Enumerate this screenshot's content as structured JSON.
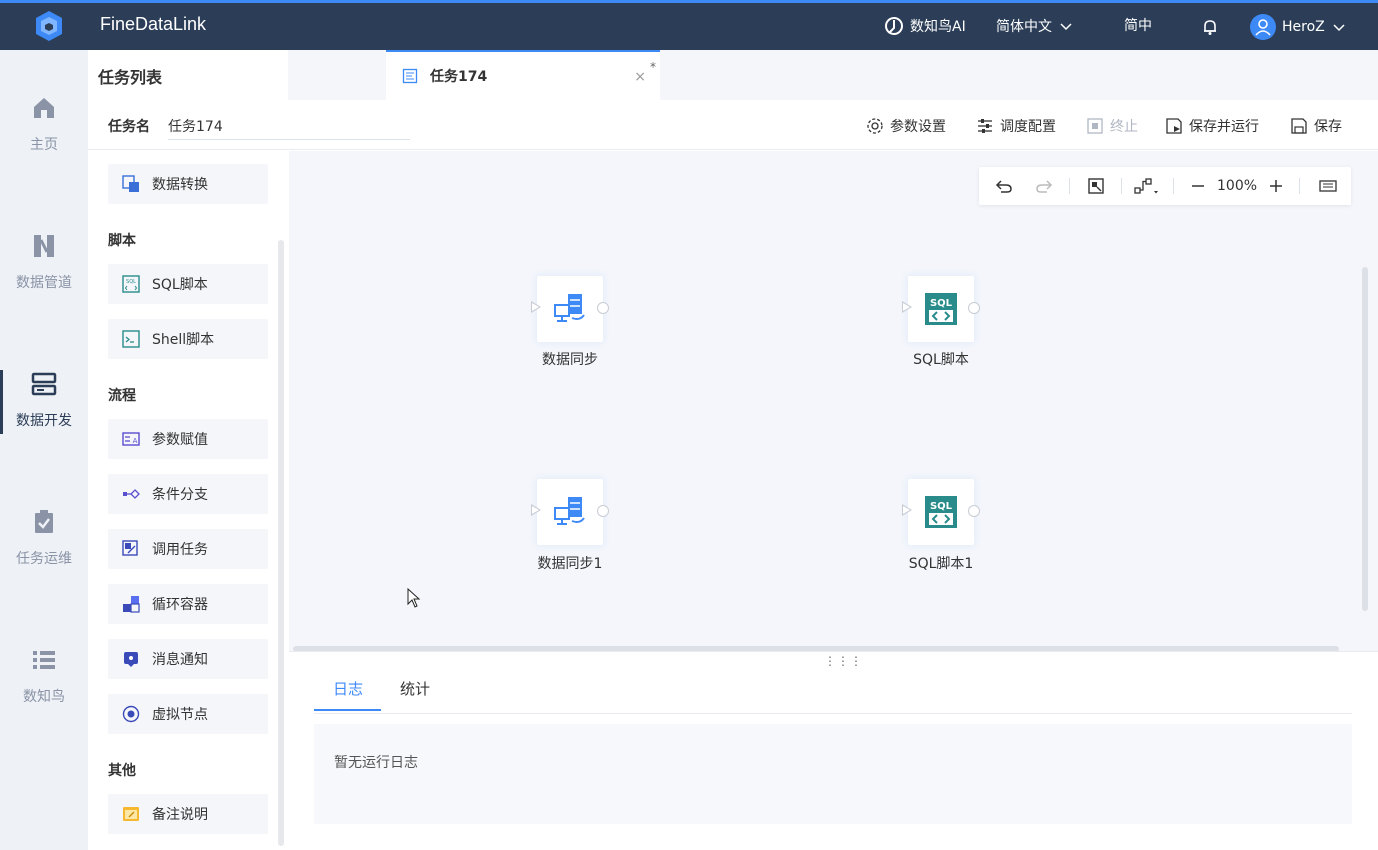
{
  "app": {
    "title": "FineDataLink",
    "brand_color": "#2c3e57",
    "accent_color": "#3d8af7"
  },
  "topbar": {
    "ai_label": "数知鸟AI",
    "language": "简体中文",
    "locale_short": "简中",
    "user": "HeroZ",
    "icons": [
      "cube-logo-icon",
      "ai-bird-icon",
      "chevron-down-icon",
      "bell-icon",
      "user-avatar-icon"
    ]
  },
  "leftnav": {
    "items": [
      {
        "label": "主页",
        "icon": "home-icon"
      },
      {
        "label": "数据管道",
        "icon": "pipeline-icon"
      },
      {
        "label": "数据开发",
        "icon": "dev-icon"
      },
      {
        "label": "任务运维",
        "icon": "task-ops-icon"
      },
      {
        "label": "数知鸟",
        "icon": "list-icon"
      }
    ],
    "active": "数据开发"
  },
  "panel": {
    "title": "任务列表",
    "components": [
      {
        "label": "数据转换",
        "icon": "data-transform-icon"
      }
    ],
    "groups": [
      {
        "label": "脚本",
        "items": [
          {
            "label": "SQL脚本",
            "icon": "sql-script-icon"
          },
          {
            "label": "Shell脚本",
            "icon": "shell-script-icon"
          }
        ]
      },
      {
        "label": "流程",
        "items": [
          {
            "label": "参数赋值",
            "icon": "param-assign-icon"
          },
          {
            "label": "条件分支",
            "icon": "condition-branch-icon"
          },
          {
            "label": "调用任务",
            "icon": "call-task-icon"
          },
          {
            "label": "循环容器",
            "icon": "loop-container-icon"
          },
          {
            "label": "消息通知",
            "icon": "message-notify-icon"
          },
          {
            "label": "虚拟节点",
            "icon": "virtual-node-icon"
          }
        ]
      },
      {
        "label": "其他",
        "items": [
          {
            "label": "备注说明",
            "icon": "note-icon"
          }
        ]
      }
    ]
  },
  "tab": {
    "label": "任务174",
    "modified_mark": "*",
    "close": "×"
  },
  "task": {
    "name_label": "任务名",
    "name_value": "任务174",
    "actions": [
      {
        "label": "参数设置",
        "icon": "gear-icon",
        "enabled": true
      },
      {
        "label": "调度配置",
        "icon": "sliders-icon",
        "enabled": true
      },
      {
        "label": "终止",
        "icon": "stop-icon",
        "enabled": false
      },
      {
        "label": "保存并运行",
        "icon": "save-run-icon",
        "enabled": true
      },
      {
        "label": "保存",
        "icon": "save-icon",
        "enabled": true
      }
    ]
  },
  "canvas": {
    "zoom": "100%",
    "toolbar_icons": [
      "undo-icon",
      "redo-icon",
      "fit-view-icon",
      "layout-icon",
      "zoom-out-icon",
      "zoom-in-icon",
      "minimap-icon"
    ],
    "nodes": [
      {
        "label": "数据同步",
        "icon": "data-sync-icon"
      },
      {
        "label": "SQL脚本",
        "icon": "sql-node-icon"
      },
      {
        "label": "数据同步1",
        "icon": "data-sync-icon"
      },
      {
        "label": "SQL脚本1",
        "icon": "sql-node-icon"
      }
    ]
  },
  "log": {
    "tabs": [
      "日志",
      "统计"
    ],
    "active_tab": "日志",
    "empty_text": "暂无运行日志",
    "grip": "⋮⋮⋮"
  }
}
